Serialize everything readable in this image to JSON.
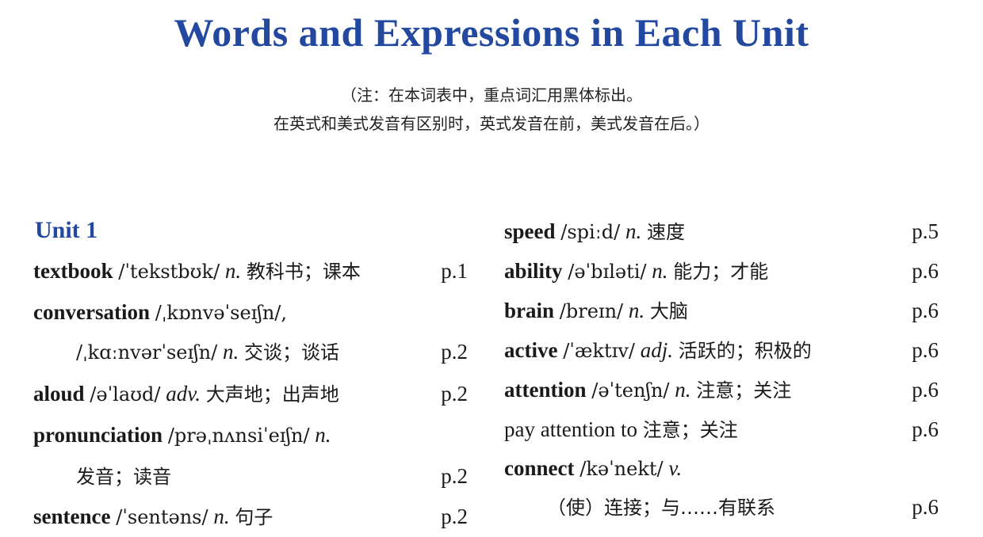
{
  "title": "Words and Expressions in Each Unit",
  "note": {
    "line1": "（注：在本词表中，重点词汇用黑体标出。",
    "line2": "在英式和美式发音有区别时，英式发音在前，美式发音在后。）"
  },
  "unit_title": "Unit 1",
  "left_entries": [
    {
      "word": "textbook",
      "phon": "/ˈtekstbʊk/",
      "pos": "n.",
      "cn": "教科书；课本",
      "page": "p.1"
    },
    {
      "word": "conversation",
      "phon": "/ˌkɒnvəˈseɪʃn/,",
      "pos": "",
      "cn": "",
      "page": ""
    },
    {
      "word": "",
      "phon": "/ˌkɑːnvərˈseɪʃn/",
      "pos": "n.",
      "cn": "交谈；谈话",
      "page": "p.2"
    },
    {
      "word": "aloud",
      "phon": "/əˈlaʊd/",
      "pos": "adv.",
      "cn": "大声地；出声地",
      "page": "p.2"
    },
    {
      "word": "pronunciation",
      "phon": "/prəˌnʌnsiˈeɪʃn/",
      "pos": "n.",
      "cn": "",
      "page": ""
    },
    {
      "word": "",
      "phon": "",
      "pos": "",
      "cn": "发音；读音",
      "page": "p.2"
    },
    {
      "word": "sentence",
      "phon": "/ˈsentəns/",
      "pos": "n.",
      "cn": "句子",
      "page": "p.2"
    }
  ],
  "right_entries": [
    {
      "word": "speed",
      "phon": "/spiːd/",
      "pos": "n.",
      "cn": "速度",
      "page": "p.5"
    },
    {
      "word": "ability",
      "phon": "/əˈbɪləti/",
      "pos": "n.",
      "cn": "能力；才能",
      "page": "p.6"
    },
    {
      "word": "brain",
      "phon": "/breɪn/",
      "pos": "n.",
      "cn": "大脑",
      "page": "p.6"
    },
    {
      "word": "active",
      "phon": "/ˈæktɪv/",
      "pos": "adj.",
      "cn": "活跃的；积极的",
      "page": "p.6"
    },
    {
      "word": "attention",
      "phon": "/əˈtenʃn/",
      "pos": "n.",
      "cn": "注意；关注",
      "page": "p.6"
    },
    {
      "word": "pay attention to",
      "phon": "",
      "pos": "",
      "cn": "注意；关注",
      "page": "p.6"
    },
    {
      "word": "connect",
      "phon": "/kəˈnekt/",
      "pos": "v.",
      "cn": "",
      "page": ""
    },
    {
      "word": "",
      "phon": "",
      "pos": "",
      "cn": "（使）连接；与……有联系",
      "page": "p.6"
    }
  ]
}
